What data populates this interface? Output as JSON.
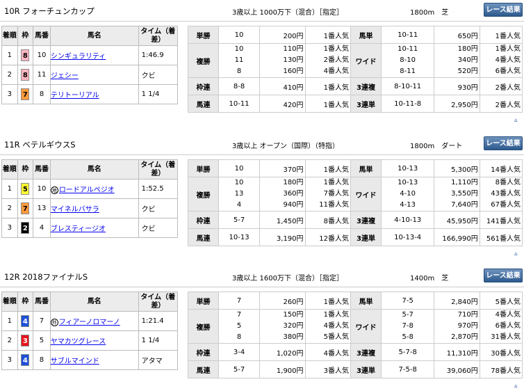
{
  "headers": [
    "着順",
    "枠",
    "馬番",
    "馬名",
    "タイム（着差）"
  ],
  "button_label": "レース結果",
  "up_icon": "▵",
  "races": [
    {
      "name": "10R フォーチュンカップ",
      "conditions": "3歳以上 1000万下（混合）［指定］",
      "distance": "1800m　芝",
      "results": [
        {
          "pos": "1",
          "frame": "8",
          "frame_bg": "#ffb6c1",
          "frame_fg": "#000",
          "num": "10",
          "mark": "",
          "horse": "シンギュラリティ",
          "time": "1:46.9"
        },
        {
          "pos": "2",
          "frame": "8",
          "frame_bg": "#ffb6c1",
          "frame_fg": "#000",
          "num": "11",
          "mark": "",
          "horse": "ジェシー",
          "time": "クビ"
        },
        {
          "pos": "3",
          "frame": "7",
          "frame_bg": "#ff9a3c",
          "frame_fg": "#000",
          "num": "8",
          "mark": "",
          "horse": "テリトーリアル",
          "time": "1 1/4"
        }
      ],
      "pay": {
        "tansho": {
          "label": "単勝",
          "num": "10",
          "amt": "200円",
          "pop": "1番人気"
        },
        "umatan": {
          "label": "馬単",
          "num": "10-11",
          "amt": "650円",
          "pop": "1番人気"
        },
        "fukusho": {
          "label": "複勝",
          "rows": [
            {
              "num": "10",
              "amt": "110円",
              "pop": "1番人気"
            },
            {
              "num": "11",
              "amt": "130円",
              "pop": "2番人気"
            },
            {
              "num": "8",
              "amt": "160円",
              "pop": "4番人気"
            }
          ]
        },
        "wide": {
          "label": "ワイド",
          "rows": [
            {
              "num": "10-11",
              "amt": "180円",
              "pop": "1番人気"
            },
            {
              "num": "8-10",
              "amt": "340円",
              "pop": "4番人気"
            },
            {
              "num": "8-11",
              "amt": "520円",
              "pop": "6番人気"
            }
          ]
        },
        "wakuren": {
          "label": "枠連",
          "num": "8-8",
          "amt": "410円",
          "pop": "1番人気"
        },
        "sanrenpuku": {
          "label": "3連複",
          "num": "8-10-11",
          "amt": "930円",
          "pop": "2番人気"
        },
        "umaren": {
          "label": "馬連",
          "num": "10-11",
          "amt": "420円",
          "pop": "1番人気"
        },
        "sanrentan": {
          "label": "3連単",
          "num": "10-11-8",
          "amt": "2,950円",
          "pop": "2番人気"
        }
      }
    },
    {
      "name": "11R ベテルギウスS",
      "conditions": "3歳以上 オープン（国際）（特指）",
      "distance": "1800m　ダート",
      "results": [
        {
          "pos": "1",
          "frame": "5",
          "frame_bg": "#ffff33",
          "frame_fg": "#000",
          "num": "10",
          "mark": "地",
          "horse": "ロードアルペジオ",
          "time": "1:52.5"
        },
        {
          "pos": "2",
          "frame": "7",
          "frame_bg": "#ff9a3c",
          "frame_fg": "#000",
          "num": "13",
          "mark": "",
          "horse": "マイネルバサラ",
          "time": "クビ"
        },
        {
          "pos": "3",
          "frame": "2",
          "frame_bg": "#000000",
          "frame_fg": "#fff",
          "num": "4",
          "mark": "",
          "horse": "ブレスティージオ",
          "time": "クビ"
        }
      ],
      "pay": {
        "tansho": {
          "label": "単勝",
          "num": "10",
          "amt": "370円",
          "pop": "1番人気"
        },
        "umatan": {
          "label": "馬単",
          "num": "10-13",
          "amt": "5,300円",
          "pop": "14番人気"
        },
        "fukusho": {
          "label": "複勝",
          "rows": [
            {
              "num": "10",
              "amt": "180円",
              "pop": "1番人気"
            },
            {
              "num": "13",
              "amt": "360円",
              "pop": "7番人気"
            },
            {
              "num": "4",
              "amt": "940円",
              "pop": "11番人気"
            }
          ]
        },
        "wide": {
          "label": "ワイド",
          "rows": [
            {
              "num": "10-13",
              "amt": "1,110円",
              "pop": "8番人気"
            },
            {
              "num": "4-10",
              "amt": "3,550円",
              "pop": "43番人気"
            },
            {
              "num": "4-13",
              "amt": "7,640円",
              "pop": "67番人気"
            }
          ]
        },
        "wakuren": {
          "label": "枠連",
          "num": "5-7",
          "amt": "1,450円",
          "pop": "8番人気"
        },
        "sanrenpuku": {
          "label": "3連複",
          "num": "4-10-13",
          "amt": "45,950円",
          "pop": "141番人気"
        },
        "umaren": {
          "label": "馬連",
          "num": "10-13",
          "amt": "3,190円",
          "pop": "12番人気"
        },
        "sanrentan": {
          "label": "3連単",
          "num": "10-13-4",
          "amt": "166,990円",
          "pop": "561番人気"
        }
      }
    },
    {
      "name": "12R 2018ファイナルS",
      "conditions": "3歳以上 1600万下（混合）［指定］",
      "distance": "1400m　芝",
      "results": [
        {
          "pos": "1",
          "frame": "4",
          "frame_bg": "#1e50d8",
          "frame_fg": "#fff",
          "num": "7",
          "mark": "外",
          "horse": "フィアーノロマーノ",
          "time": "1:21.4"
        },
        {
          "pos": "2",
          "frame": "3",
          "frame_bg": "#e8141b",
          "frame_fg": "#fff",
          "num": "5",
          "mark": "",
          "horse": "ヤマカツグレース",
          "time": "1 1/4"
        },
        {
          "pos": "3",
          "frame": "4",
          "frame_bg": "#1e50d8",
          "frame_fg": "#fff",
          "num": "8",
          "mark": "",
          "horse": "サブルマインド",
          "time": "アタマ"
        }
      ],
      "pay": {
        "tansho": {
          "label": "単勝",
          "num": "7",
          "amt": "260円",
          "pop": "1番人気"
        },
        "umatan": {
          "label": "馬単",
          "num": "7-5",
          "amt": "2,840円",
          "pop": "5番人気"
        },
        "fukusho": {
          "label": "複勝",
          "rows": [
            {
              "num": "7",
              "amt": "150円",
              "pop": "1番人気"
            },
            {
              "num": "5",
              "amt": "320円",
              "pop": "4番人気"
            },
            {
              "num": "8",
              "amt": "380円",
              "pop": "5番人気"
            }
          ]
        },
        "wide": {
          "label": "ワイド",
          "rows": [
            {
              "num": "5-7",
              "amt": "710円",
              "pop": "4番人気"
            },
            {
              "num": "7-8",
              "amt": "970円",
              "pop": "6番人気"
            },
            {
              "num": "5-8",
              "amt": "2,870円",
              "pop": "31番人気"
            }
          ]
        },
        "wakuren": {
          "label": "枠連",
          "num": "3-4",
          "amt": "1,020円",
          "pop": "4番人気"
        },
        "sanrenpuku": {
          "label": "3連複",
          "num": "5-7-8",
          "amt": "11,310円",
          "pop": "30番人気"
        },
        "umaren": {
          "label": "馬連",
          "num": "5-7",
          "amt": "1,900円",
          "pop": "3番人気"
        },
        "sanrentan": {
          "label": "3連単",
          "num": "7-5-8",
          "amt": "39,060円",
          "pop": "78番人気"
        }
      }
    }
  ]
}
